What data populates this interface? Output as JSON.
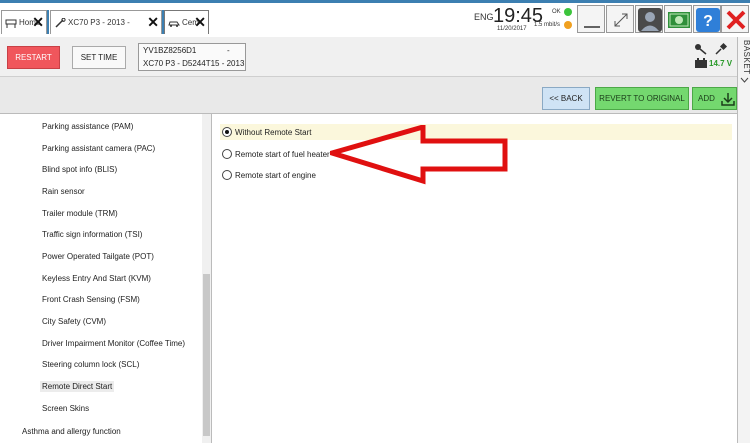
{
  "tabs": [
    {
      "label": "Home",
      "icon": "car-lift-icon"
    },
    {
      "label": "XC70 P3 - 2013 -",
      "icon": "wrench-icon"
    },
    {
      "label": "Cem",
      "icon": "car-icon"
    }
  ],
  "status": {
    "language": "ENG",
    "time": "19:45",
    "date": "11/20/2017",
    "connection_label": "OK",
    "connection_rate": "1.5 mbit/s",
    "ok_color": "#3cc43c",
    "rate_color": "#f0a020"
  },
  "toolbar": {
    "restart_label": "RESTART",
    "settime_label": "SET TIME",
    "vin": "YV1BZ8256D1",
    "vin_suffix": "-",
    "model": "XC70 P3 - D5244T15 - 2013",
    "voltage": "14.7 V"
  },
  "basket_label": "BASKET",
  "actions": {
    "back_label": "<< BACK",
    "revert_label": "REVERT TO ORIGINAL",
    "add_label": "ADD"
  },
  "function_list": {
    "items": [
      "Parking assistance (PAM)",
      "Parking assistant camera (PAC)",
      "Blind spot info (BLIS)",
      "Rain sensor",
      "Trailer module (TRM)",
      "Traffic sign information (TSI)",
      "Power Operated Tailgate (POT)",
      "Keyless Entry And Start (KVM)",
      "Front Crash Sensing (FSM)",
      "City Safety (CVM)",
      "Driver Impairment Monitor (Coffee Time)",
      "Steering column lock (SCL)",
      "Remote Direct Start",
      "Screen Skins"
    ],
    "selected": "Remote Direct Start",
    "group": "Asthma and allergy function"
  },
  "options": [
    {
      "label": "Without Remote Start",
      "checked": true
    },
    {
      "label": "Remote start of fuel heater",
      "checked": false
    },
    {
      "label": "Remote start of engine",
      "checked": false
    }
  ],
  "colors": {
    "accent": "#3c7fb1",
    "restart": "#f0565c",
    "green_button": "#74d86f",
    "annotation_arrow": "#e01010"
  }
}
